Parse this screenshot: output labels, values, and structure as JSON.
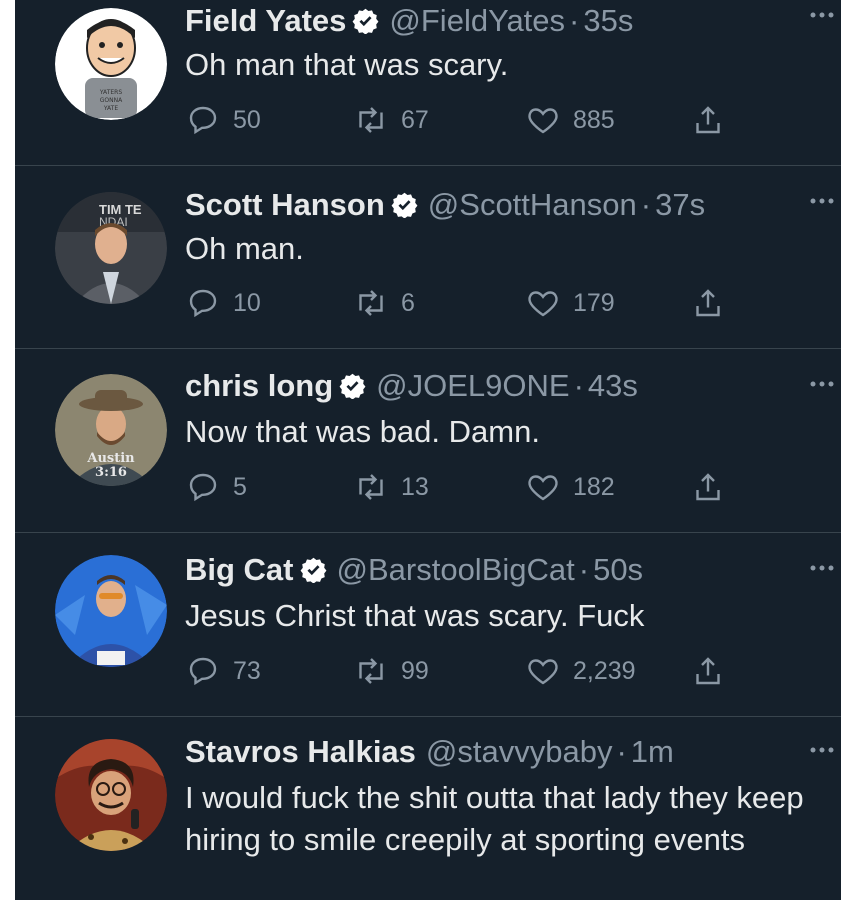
{
  "tweets": [
    {
      "name": "Field Yates",
      "verified": true,
      "handle": "@FieldYates",
      "separator": "·",
      "time": "35s",
      "text": "Oh man that was scary.",
      "replies": "50",
      "retweets": "67",
      "likes": "885",
      "avatar_shirt_text": "YATERS GONNA YATE"
    },
    {
      "name": "Scott Hanson",
      "verified": true,
      "handle": "@ScottHanson",
      "separator": "·",
      "time": "37s",
      "text": "Oh man.",
      "replies": "10",
      "retweets": "6",
      "likes": "179",
      "avatar_bg_text": "TIM TE NDAI"
    },
    {
      "name": "chris long",
      "verified": true,
      "handle": "@JOEL9ONE",
      "separator": "·",
      "time": "43s",
      "text": "Now that was bad. Damn.",
      "replies": "5",
      "retweets": "13",
      "likes": "182",
      "avatar_shirt_text": "Austin 3:16"
    },
    {
      "name": "Big Cat",
      "verified": true,
      "handle": "@BarstoolBigCat",
      "separator": "·",
      "time": "50s",
      "text": "Jesus Christ that was scary. Fuck",
      "replies": "73",
      "retweets": "99",
      "likes": "2,239"
    },
    {
      "name": "Stavros Halkias",
      "verified": false,
      "handle": "@stavvybaby",
      "separator": "·",
      "time": "1m",
      "text": "I would fuck the shit outta that lady they keep hiring to smile creepily at sporting events"
    }
  ],
  "icons": {
    "reply": "reply-icon",
    "retweet": "retweet-icon",
    "like": "heart-icon",
    "share": "share-icon",
    "more": "more-icon",
    "verified": "verified-badge-icon"
  },
  "colors": {
    "background": "#15202b",
    "text": "#e7e9ea",
    "secondary": "#8b98a5",
    "verified": "#ffffff",
    "divider": "#38444d"
  }
}
